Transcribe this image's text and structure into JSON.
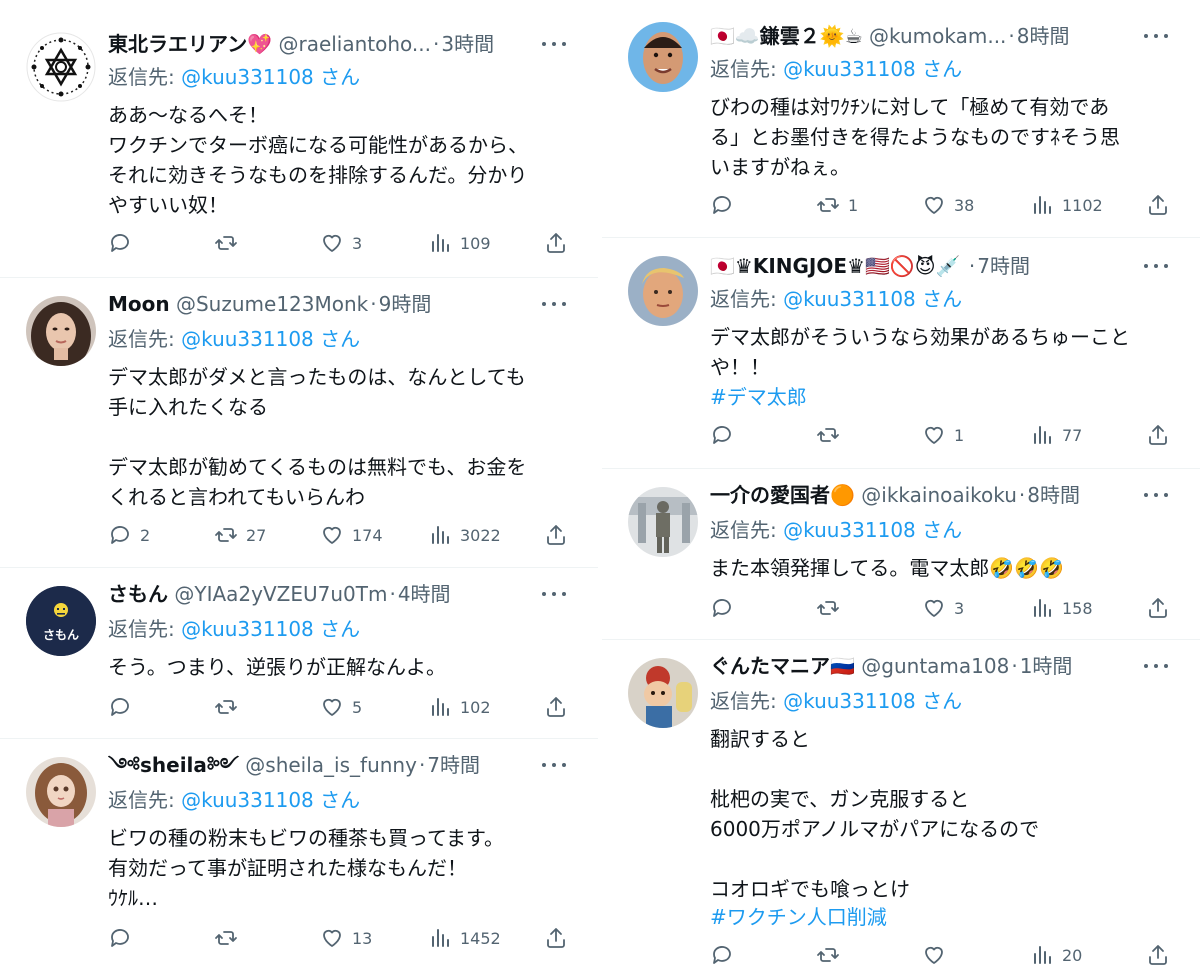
{
  "tweets_left": [
    {
      "name": "東北ラエリアン💖",
      "handle": "@raeliantoho...",
      "time": "3時間",
      "reply_prefix": "返信先: ",
      "reply_to": "@kuu331108 さん",
      "text": "ああ〜なるへそ！\nワクチンでターボ癌になる可能性があるから、\nそれに効きそうなものを排除するんだ。分かり\nやすいい奴！",
      "hashtag": "",
      "replies": "",
      "retweets": "",
      "likes": "3",
      "views": "109"
    },
    {
      "name": "Moon",
      "handle": "@Suzume123Monk",
      "time": "9時間",
      "reply_prefix": "返信先: ",
      "reply_to": "@kuu331108 さん",
      "text": "デマ太郎がダメと言ったものは、なんとしても\n手に入れたくなる\n\nデマ太郎が勧めてくるものは無料でも、お金を\nくれると言われてもいらんわ",
      "hashtag": "",
      "replies": "2",
      "retweets": "27",
      "likes": "174",
      "views": "3022"
    },
    {
      "name": "さもん",
      "handle": "@YIAa2yVZEU7u0Tm",
      "time": "4時間",
      "reply_prefix": "返信先: ",
      "reply_to": "@kuu331108 さん",
      "text": "そう。つまり、逆張りが正解なんよ。",
      "hashtag": "",
      "replies": "",
      "retweets": "",
      "likes": "5",
      "views": "102",
      "avatar_text": "さもん"
    },
    {
      "name": "༺sheila༻",
      "handle": "@sheila_is_funny",
      "time": "7時間",
      "reply_prefix": "返信先: ",
      "reply_to": "@kuu331108 さん",
      "text": "ビワの種の粉末もビワの種茶も買ってます。\n有効だって事が証明された様なもんだ！\nｳｹﾙ…",
      "hashtag": "",
      "replies": "",
      "retweets": "",
      "likes": "13",
      "views": "1452"
    }
  ],
  "tweets_right": [
    {
      "name": "🇯🇵☁️鎌雲２🌞☕",
      "handle": "@kumokam...",
      "time": "8時間",
      "reply_prefix": "返信先: ",
      "reply_to": "@kuu331108 さん",
      "text": "びわの種は対ﾜｸﾁﾝに対して「極めて有効であ\nる」とお墨付きを得たようなものですﾈそう思\nいますがねぇ。",
      "hashtag": "",
      "replies": "",
      "retweets": "1",
      "likes": "38",
      "views": "1102"
    },
    {
      "name": "🇯🇵♛KINGJOE♛🇺🇸🚫😈💉",
      "handle": "",
      "time": "7時間",
      "reply_prefix": "返信先: ",
      "reply_to": "@kuu331108 さん",
      "text": "デマ太郎がそういうなら効果があるちゅーこと\nや！！",
      "hashtag": "#デマ太郎",
      "replies": "",
      "retweets": "",
      "likes": "1",
      "views": "77"
    },
    {
      "name": "一介の愛国者🟠",
      "handle": "@ikkainoaikoku",
      "time": "8時間",
      "reply_prefix": "返信先: ",
      "reply_to": "@kuu331108 さん",
      "text": "また本領発揮してる。電マ太郎🤣🤣🤣",
      "hashtag": "",
      "replies": "",
      "retweets": "",
      "likes": "3",
      "views": "158"
    },
    {
      "name": "ぐんたマニア🇷🇺",
      "handle": "@guntama108",
      "time": "1時間",
      "reply_prefix": "返信先: ",
      "reply_to": "@kuu331108 さん",
      "text": "翻訳すると\n\n枇杷の実で、ガン克服すると\n6000万ポアノルマがパアになるので\n\nコオロギでも喰っとけ",
      "hashtag": "#ワクチン人口削減",
      "replies": "",
      "retweets": "",
      "likes": "",
      "views": "20"
    }
  ],
  "colors": {
    "text": "#0f1419",
    "secondary": "#536471",
    "link": "#1d9bf0",
    "separator": "#eff3f4",
    "samon_avatar_bg": "#1c2a4a",
    "samon_emoji": "#f5d63c"
  },
  "icons": [
    "reply-icon",
    "retweet-icon",
    "like-icon",
    "views-icon",
    "share-icon",
    "more-icon"
  ]
}
